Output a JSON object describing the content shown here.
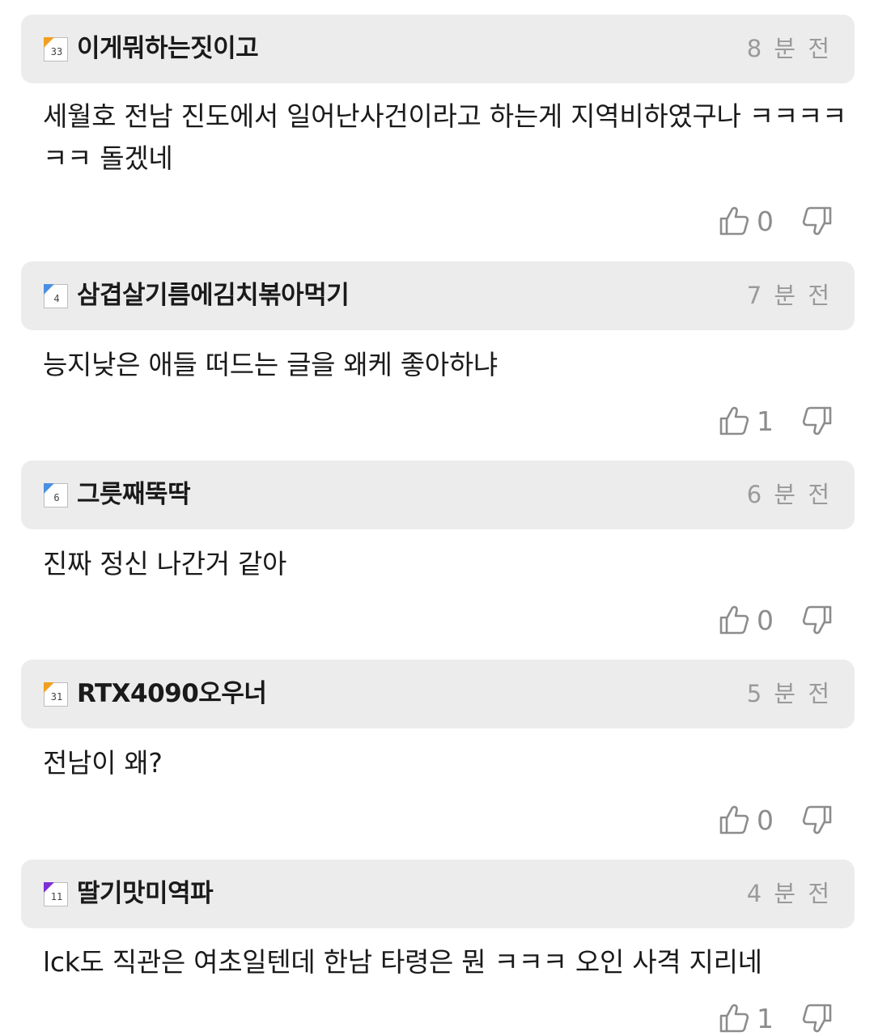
{
  "colors": {
    "header_bg": "#ececec",
    "username_text": "#1a1a1a",
    "timestamp_text": "#9a9a9a",
    "icon_gray": "#8c8c8c"
  },
  "comments": [
    {
      "level": "33",
      "level_color": "#f0a020",
      "username": "이게뭐하는짓이고",
      "time": "8 분 전",
      "body": "세월호 전남 진도에서 일어난사건이라고 하는게 지역비하였구나 ㅋㅋㅋㅋㅋㅋ 돌겠네",
      "likes": "0"
    },
    {
      "level": "4",
      "level_color": "#4a90e2",
      "username": "삼겹살기름에김치볶아먹기",
      "time": "7 분 전",
      "body": "능지낮은 애들 떠드는 글을 왜케 좋아하냐",
      "likes": "1"
    },
    {
      "level": "6",
      "level_color": "#4a90e2",
      "username": "그릇째뚝딱",
      "time": "6 분 전",
      "body": "진짜 정신 나간거 같아",
      "likes": "0"
    },
    {
      "level": "31",
      "level_color": "#f0a020",
      "username": "RTX4090오우너",
      "time": "5 분 전",
      "body": "전남이 왜?",
      "likes": "0"
    },
    {
      "level": "11",
      "level_color": "#7b2fd6",
      "username": "딸기맛미역파",
      "time": "4 분 전",
      "body": "lck도 직관은 여초일텐데 한남 타령은 뭔 ㅋㅋㅋ 오인 사격 지리네",
      "likes": "1"
    }
  ]
}
